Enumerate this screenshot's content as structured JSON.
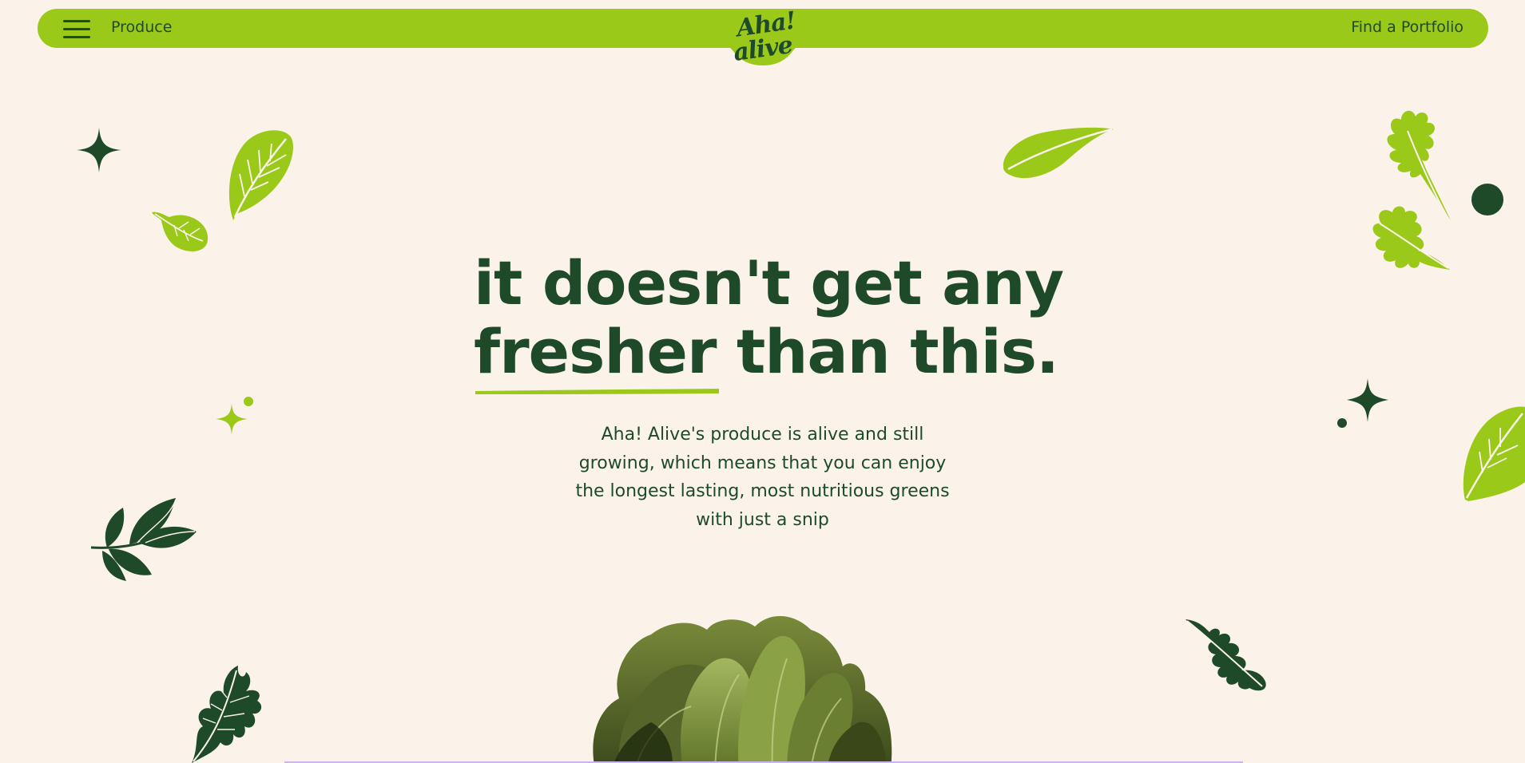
{
  "header": {
    "menu_icon": "hamburger-menu-icon",
    "produce_label": "Produce",
    "logo_line1": "Aha!",
    "logo_line2": "alive",
    "portfolio_label": "Find a Portfolio"
  },
  "hero": {
    "headline_line1": "it doesn't get any",
    "headline_fresher": "fresher",
    "headline_rest": "than this.",
    "subtext": "Aha! Alive's produce is alive and still growing, which means that you can enjoy the longest lasting, most nutritious greens with just a snip"
  },
  "colors": {
    "background": "#fbf3ea",
    "brand_green": "#9bc919",
    "dark_green": "#1f4a2a"
  },
  "decorations": [
    "sparkle-icon",
    "leaf-icon",
    "arugula-leaf-icon",
    "dot-icon",
    "herb-sprig-icon",
    "parsley-leaf-icon",
    "lettuce-image"
  ]
}
